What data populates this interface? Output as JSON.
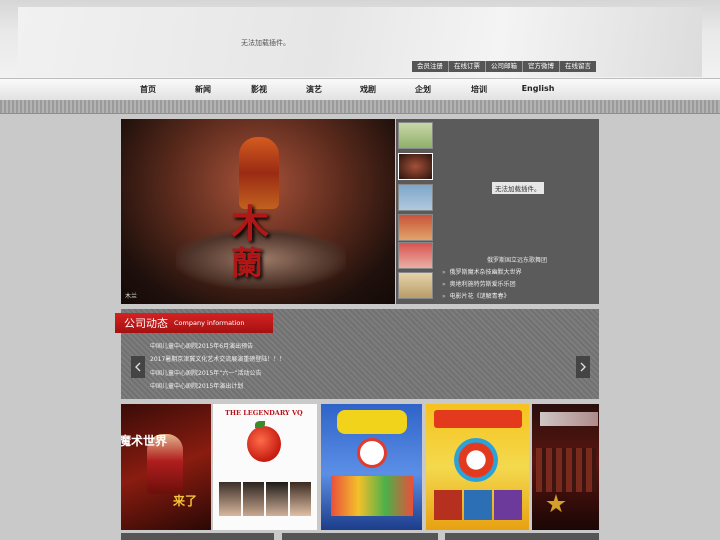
{
  "header": {
    "plugin_message": "无法加载插件。",
    "top_links": [
      "会员注册",
      "在线订票",
      "公司邮箱",
      "官方微博",
      "在线留言"
    ]
  },
  "main_nav": [
    "首页",
    "新闻",
    "影视",
    "演艺",
    "戏剧",
    "企划",
    "培训",
    "English"
  ],
  "hero": {
    "title_char_1": "木",
    "title_char_2": "蘭",
    "caption": "木兰"
  },
  "right_panel": {
    "plugin_message": "无法加载插件。",
    "news_title": "俄罗斯国立远东歌舞团",
    "items": [
      "俄罗斯魔术杂技幽默大世界",
      "奥地利施特劳斯爱乐乐团",
      "电影片花《谜解青春》"
    ]
  },
  "company": {
    "title_zh": "公司动态",
    "title_en": "Company information",
    "items": [
      "中国儿童中心剧院2015年6月演出预告",
      "2017暑期京津冀文化艺术交流展演重磅登陆！！！",
      "中国儿童中心剧院2015年“六一”活动公告",
      "中国儿童中心剧院2015年演出计划"
    ]
  },
  "posters": [
    {
      "name": "poster-magic-world",
      "text_1": "魔术世界",
      "text_2": "来了"
    },
    {
      "name": "poster-legendary-vq",
      "text_1": "THE LEGENDARY VQ"
    },
    {
      "name": "poster-clown",
      "text_1": ""
    },
    {
      "name": "poster-circus",
      "text_1": ""
    },
    {
      "name": "poster-concert",
      "text_1": ""
    }
  ],
  "colors": {
    "accent_red": "#c41a1a",
    "nav_bg": "#555555",
    "panel_bg": "#5b5b5b"
  }
}
